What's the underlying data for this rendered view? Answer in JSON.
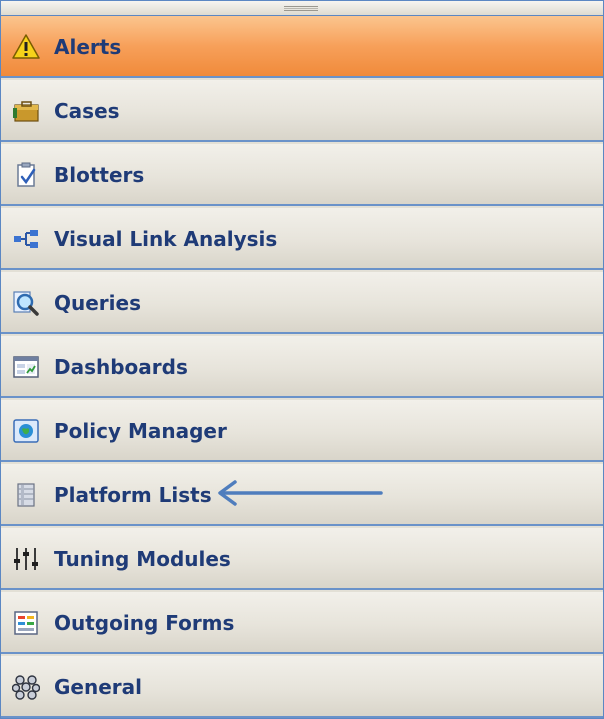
{
  "nav": {
    "items": [
      {
        "label": "Alerts",
        "icon": "warning-icon",
        "active": true
      },
      {
        "label": "Cases",
        "icon": "briefcase-icon"
      },
      {
        "label": "Blotters",
        "icon": "clipboard-check-icon"
      },
      {
        "label": "Visual Link Analysis",
        "icon": "link-diagram-icon"
      },
      {
        "label": "Queries",
        "icon": "magnifier-icon"
      },
      {
        "label": "Dashboards",
        "icon": "dashboard-icon"
      },
      {
        "label": "Policy Manager",
        "icon": "policy-globe-icon"
      },
      {
        "label": "Platform Lists",
        "icon": "list-database-icon"
      },
      {
        "label": "Tuning Modules",
        "icon": "sliders-icon"
      },
      {
        "label": "Outgoing Forms",
        "icon": "form-icon"
      },
      {
        "label": "General",
        "icon": "cluster-icon"
      }
    ]
  },
  "colors": {
    "active_bg": "#f7a05a",
    "label_text": "#1f3b77",
    "divider": "#6a92c9",
    "arrow": "#4f7dbd"
  }
}
